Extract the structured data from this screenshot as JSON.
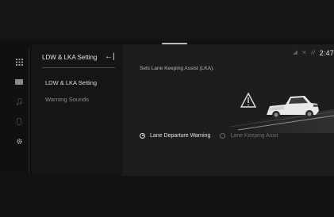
{
  "status_bar": {
    "time": "2:47",
    "icons": [
      "signal-icon",
      "no-phone-icon",
      "wireless-icon"
    ]
  },
  "sidebar_icons": [
    "apps-grid-icon",
    "media-icon",
    "music-icon",
    "phone-icon",
    "settings-icon"
  ],
  "submenu": {
    "title": "LDW & LKA Setting",
    "back_glyph": "←|",
    "items": [
      {
        "label": "LDW & LKA Setting",
        "active": true
      },
      {
        "label": "Warning Sounds",
        "active": false
      }
    ]
  },
  "main": {
    "description": "Sets Lane Keeping Assist (LKA).",
    "options": [
      {
        "label": "Lane Departure Warning",
        "selected": true
      },
      {
        "label": "Lane Keeping Asist",
        "selected": false
      }
    ]
  },
  "colors": {
    "background": "#101010",
    "panel": "#1d1d1d",
    "submenu_panel": "#151515",
    "text_primary": "#e6e6e6",
    "text_dim": "#8c8c8c"
  }
}
